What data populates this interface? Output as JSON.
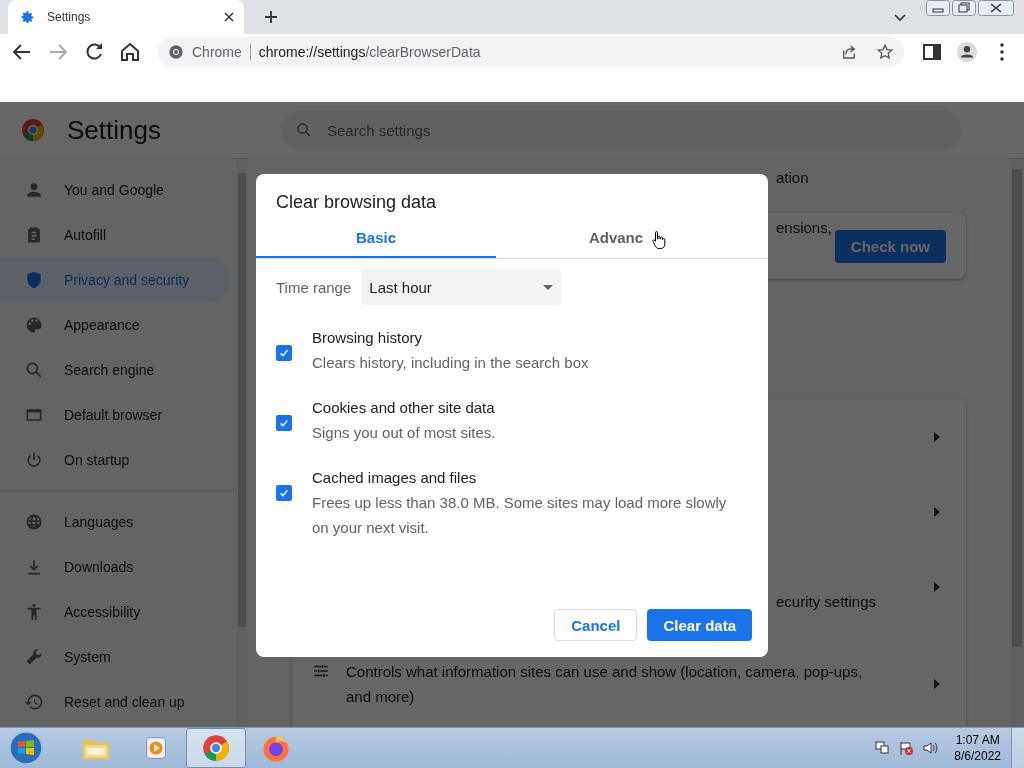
{
  "browser": {
    "tab": {
      "title": "Settings"
    },
    "omnibox": {
      "site": "Chrome",
      "url_host": "chrome://settings",
      "url_path": "/clearBrowserData"
    }
  },
  "settings": {
    "title": "Settings",
    "search": {
      "placeholder": "Search settings"
    },
    "sidebar": {
      "items": [
        {
          "label": "You and Google",
          "selected": false
        },
        {
          "label": "Autofill",
          "selected": false
        },
        {
          "label": "Privacy and security",
          "selected": true
        },
        {
          "label": "Appearance",
          "selected": false
        },
        {
          "label": "Search engine",
          "selected": false
        },
        {
          "label": "Default browser",
          "selected": false
        },
        {
          "label": "On startup",
          "selected": false
        },
        {
          "label": "Languages",
          "selected": false
        },
        {
          "label": "Downloads",
          "selected": false
        },
        {
          "label": "Accessibility",
          "selected": false
        },
        {
          "label": "System",
          "selected": false
        },
        {
          "label": "Reset and clean up",
          "selected": false
        }
      ]
    },
    "partial_texts": [
      "ation",
      "ensions,",
      "ecurity settings"
    ],
    "check_button": "Check now",
    "permissions_text": "Controls what information sites can use and show (location, camera, pop-ups, and more)"
  },
  "dialog": {
    "title": "Clear browsing data",
    "tabs": [
      {
        "label": "Basic",
        "selected": true
      },
      {
        "label": "Advanc",
        "selected": false
      }
    ],
    "time_range": {
      "label": "Time range",
      "value": "Last hour"
    },
    "options": [
      {
        "label": "Browsing history",
        "description": "Clears history, including in the search box",
        "checked": true
      },
      {
        "label": "Cookies and other site data",
        "description": "Signs you out of most sites.",
        "checked": true
      },
      {
        "label": "Cached images and files",
        "description": "Frees up less than 38.0 MB. Some sites may load more slowly on your next visit.",
        "checked": true
      }
    ],
    "buttons": [
      "Cancel",
      "Clear data"
    ]
  },
  "taskbar": {
    "time": "1:07 AM",
    "date": "8/6/2022"
  }
}
